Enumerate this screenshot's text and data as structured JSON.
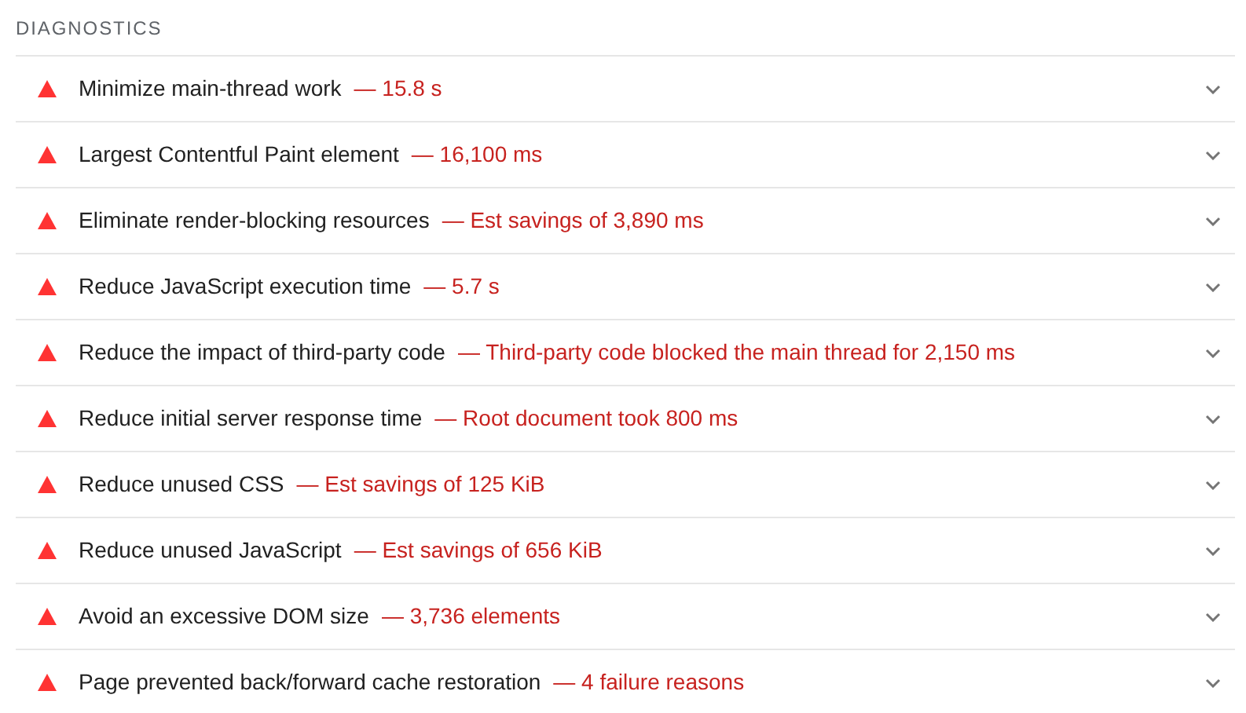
{
  "section_title": "DIAGNOSTICS",
  "audits": [
    {
      "title": "Minimize main-thread work",
      "display_value": "— 15.8 s"
    },
    {
      "title": "Largest Contentful Paint element",
      "display_value": "— 16,100 ms"
    },
    {
      "title": "Eliminate render-blocking resources",
      "display_value": "— Est savings of 3,890 ms"
    },
    {
      "title": "Reduce JavaScript execution time",
      "display_value": "— 5.7 s"
    },
    {
      "title": "Reduce the impact of third-party code",
      "display_value": "— Third-party code blocked the main thread for 2,150 ms"
    },
    {
      "title": "Reduce initial server response time",
      "display_value": "— Root document took 800 ms"
    },
    {
      "title": "Reduce unused CSS",
      "display_value": "— Est savings of 125 KiB"
    },
    {
      "title": "Reduce unused JavaScript",
      "display_value": "— Est savings of 656 KiB"
    },
    {
      "title": "Avoid an excessive DOM size",
      "display_value": "— 3,736 elements"
    },
    {
      "title": "Page prevented back/forward cache restoration",
      "display_value": "— 4 failure reasons"
    }
  ]
}
